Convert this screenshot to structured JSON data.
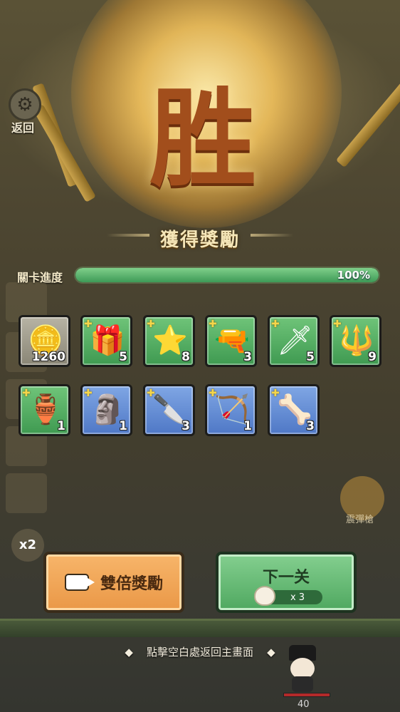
{
  "header": {
    "back_label": "返回",
    "victory_glyph": "胜"
  },
  "reward_title": "獲得獎勵",
  "progress": {
    "label": "關卡進度",
    "value_text": "100%",
    "fraction": 1.0
  },
  "rewards": [
    {
      "name": "coin",
      "icon": "coin-icon",
      "count": "1260",
      "rarity": "grey"
    },
    {
      "name": "lightning-chest",
      "icon": "chest-icon",
      "count": "5",
      "rarity": "green"
    },
    {
      "name": "star-card",
      "icon": "star-card-icon",
      "count": "8",
      "rarity": "green"
    },
    {
      "name": "pistol",
      "icon": "pistol-icon",
      "count": "3",
      "rarity": "green"
    },
    {
      "name": "green-sword",
      "icon": "sword-icon",
      "count": "5",
      "rarity": "green"
    },
    {
      "name": "ice-spear",
      "icon": "spear-icon",
      "count": "9",
      "rarity": "green"
    },
    {
      "name": "lucky-jar",
      "icon": "jar-icon",
      "count": "1",
      "rarity": "green"
    },
    {
      "name": "dragon-statue",
      "icon": "statue-icon",
      "count": "1",
      "rarity": "blue"
    },
    {
      "name": "crystal-blade",
      "icon": "blade-icon",
      "count": "3",
      "rarity": "blue"
    },
    {
      "name": "flame-bow",
      "icon": "bow-icon",
      "count": "1",
      "rarity": "blue"
    },
    {
      "name": "bone-staff",
      "icon": "staff-icon",
      "count": "3",
      "rarity": "blue"
    }
  ],
  "buttons": {
    "double_reward": "雙倍獎勵",
    "next_level": "下一关",
    "next_cost": "x 3"
  },
  "hint": "點擊空白處返回主畫面",
  "side": {
    "multiplier": "x2",
    "skill_label": "震彈槍"
  },
  "hero": {
    "hp": "40"
  },
  "colors": {
    "green_tile": "#4fa860",
    "blue_tile": "#5a82cc",
    "orange_button": "#ee9d4c"
  }
}
